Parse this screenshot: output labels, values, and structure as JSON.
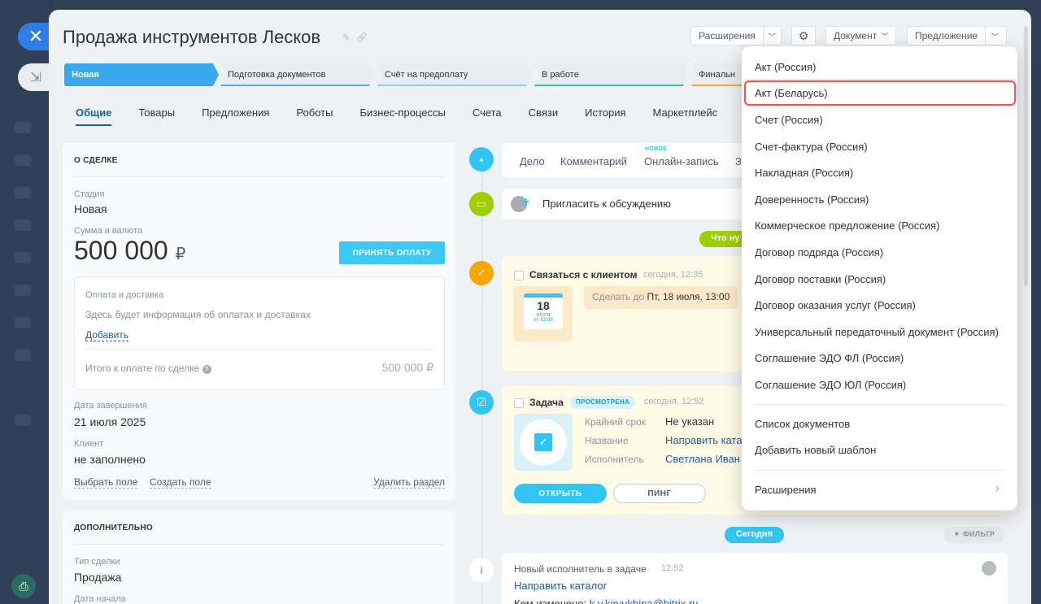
{
  "deal": {
    "title": "Продажа инструментов Лесков"
  },
  "header": {
    "extensions_label": "Расширения",
    "document_label": "Документ",
    "proposal_label": "Предложение"
  },
  "stages": [
    {
      "label": "Новая",
      "color": "#39a8ef"
    },
    {
      "label": "Подготовка документов",
      "color": "#4ab3e9"
    },
    {
      "label": "Счёт на предоплату",
      "color": "#8ad3ea"
    },
    {
      "label": "В работе",
      "color": "#36c0a3"
    },
    {
      "label": "Финальн",
      "color": "#f4a63b"
    }
  ],
  "tabs": [
    "Общие",
    "Товары",
    "Предложения",
    "Роботы",
    "Бизнес-процессы",
    "Счета",
    "Связи",
    "История",
    "Маркетплейс"
  ],
  "about": {
    "section_title": "О СДЕЛКЕ",
    "stage_label": "Стадия",
    "stage_value": "Новая",
    "amount_label": "Сумма и валюта",
    "amount_value": "500 000",
    "currency_symbol": "₽",
    "accept_payment": "ПРИНЯТЬ ОПЛАТУ",
    "payment_title": "Оплата и доставка",
    "payment_hint": "Здесь будет информация об оплатах и доставках",
    "add_link": "Добавить",
    "total_label": "Итого к оплате по сделке",
    "total_value": "500 000 ₽",
    "close_date_label": "Дата завершения",
    "close_date_value": "21 июля 2025",
    "client_label": "Клиент",
    "client_value": "не заполнено",
    "choose_field": "Выбрать поле",
    "create_field": "Создать поле",
    "delete_section": "Удалить раздел"
  },
  "additional": {
    "section_title": "ДОПОЛНИТЕЛЬНО",
    "type_label": "Тип сделки",
    "type_value": "Продажа",
    "start_label": "Дата начала"
  },
  "timeline": {
    "composer_tabs": [
      "Дело",
      "Комментарий",
      "Онлайн-запись",
      "З"
    ],
    "new_badge": "НОВОЕ",
    "invite": "Пригласить к обсуждению",
    "pill_todo": "Что ну",
    "activity": {
      "title": "Связаться с клиентом",
      "time": "сегодня, 12:35",
      "cal_day": "18",
      "cal_month": "июля",
      "cal_time": "пт 13:00",
      "deadline_prefix": "Сделать до",
      "deadline_value": "Пт, 18 июля, 13:00"
    },
    "task": {
      "title": "Задача",
      "badge": "ПРОСМОТРЕНА",
      "time": "сегодня, 12:52",
      "deadline_label": "Крайний срок",
      "deadline_value": "Не указан",
      "name_label": "Название",
      "name_value": "Направить ката",
      "assignee_label": "Исполнитель",
      "assignee_value": "Светлана Иван",
      "open_btn": "ОТКРЫТЬ",
      "ping_btn": "ПИНГ"
    },
    "today": "Сегодня",
    "filter": "ФИЛЬТР",
    "event": {
      "title": "Новый исполнитель в задаче",
      "time": "12:52",
      "link": "Направить каталог",
      "changed_by_label": "Кем изменено:",
      "changed_by_value": "k.v.kiryukhina@bitrix.ru"
    }
  },
  "document_menu": {
    "items": [
      "Акт (Россия)",
      "Акт (Беларусь)",
      "Счет (Россия)",
      "Счет-фактура (Россия)",
      "Накладная (Россия)",
      "Доверенность (Россия)",
      "Коммерческое предложение (Россия)",
      "Договор подряда (Россия)",
      "Договор поставки (Россия)",
      "Договор оказания услуг (Россия)",
      "Универсальный передаточный документ (Россия)",
      "Соглашение ЭДО ФЛ (Россия)",
      "Соглашение ЭДО ЮЛ (Россия)"
    ],
    "highlighted_item": "Акт (Беларусь)",
    "doc_list": "Список документов",
    "add_template": "Добавить новый шаблон",
    "extensions": "Расширения"
  },
  "colors": {
    "accent_blue": "#2fc6f6",
    "link_blue": "#1c5e9c",
    "highlight_red": "#ef5556",
    "timeline_green": "#9dcf00",
    "timeline_orange": "#f7a700"
  }
}
